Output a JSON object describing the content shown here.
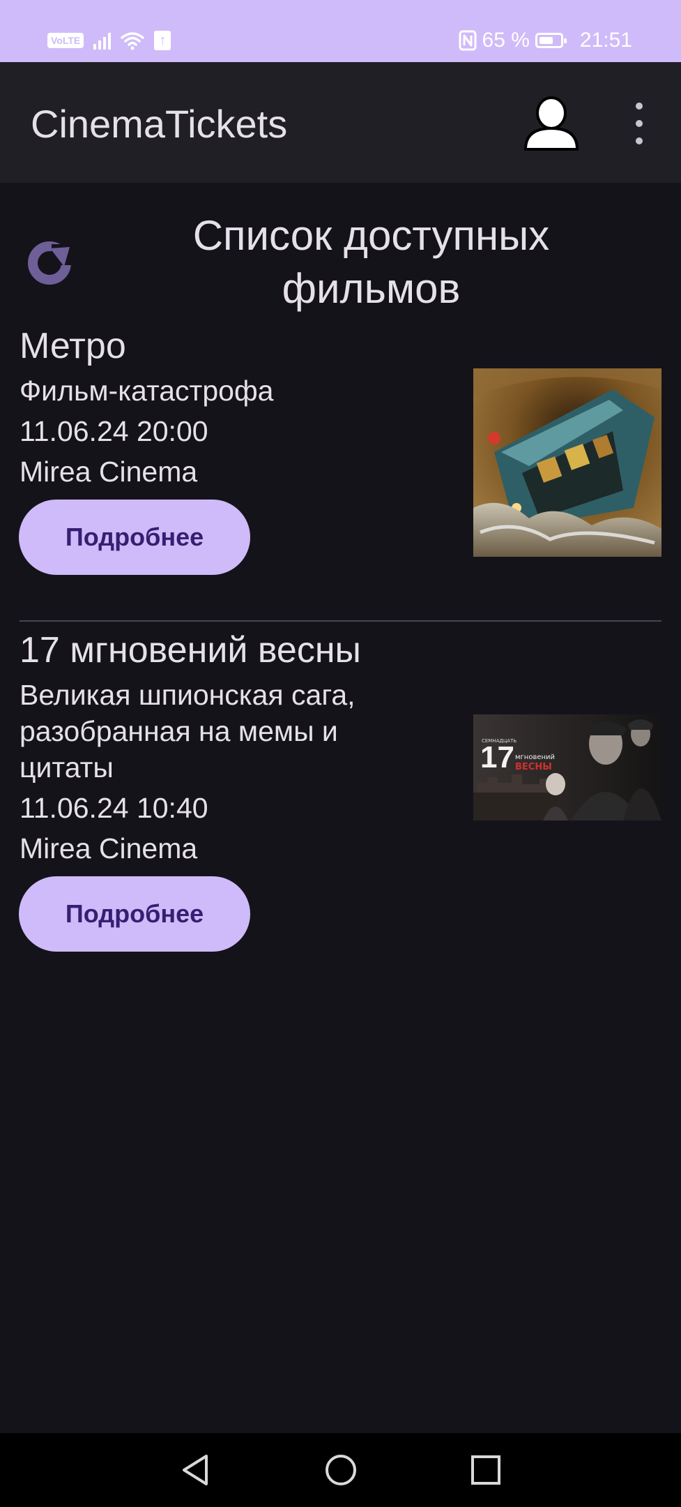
{
  "status_bar": {
    "volte": "VoLTE",
    "battery_percent": "65 %",
    "time": "21:51",
    "upload_glyph": "↑"
  },
  "app_bar": {
    "title": "CinemaTickets",
    "profile_icon": "person-icon",
    "menu_icon": "more-vert-icon"
  },
  "main": {
    "heading": "Список доступных фильмов",
    "refresh_icon": "refresh-icon"
  },
  "movies": [
    {
      "title": "Метро",
      "description": "Фильм-катастрофа",
      "datetime": "11.06.24 20:00",
      "cinema": "Mirea Cinema",
      "button_label": "Подробнее"
    },
    {
      "title": "17 мгновений весны",
      "description": "Великая шпионская сага, разобранная на мемы и цитаты",
      "datetime": "11.06.24 10:40",
      "cinema": "Mirea Cinema",
      "button_label": "Подробнее",
      "poster_number": "17",
      "poster_small_text": "мгновений",
      "poster_red_text": "ВЕСНЫ",
      "poster_top_text": "СЕМНАДЦАТЬ"
    }
  ],
  "nav_bar": {
    "back_icon": "back-triangle-icon",
    "home_icon": "home-circle-icon",
    "recents_icon": "recents-square-icon"
  },
  "colors": {
    "accent": "#cfbbf9",
    "background": "#15131a",
    "app_bar": "#211f26",
    "button_text": "#381e72"
  }
}
